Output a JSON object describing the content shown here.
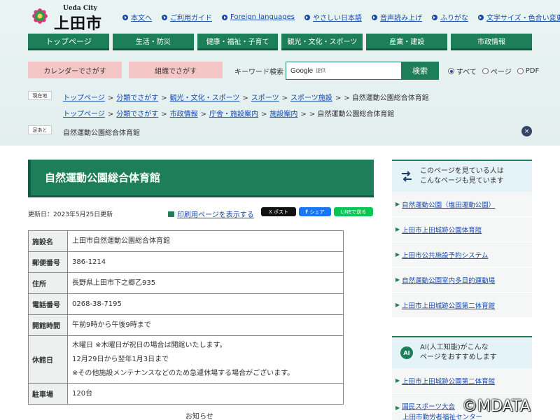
{
  "site": {
    "logo_latin": "Ueda City",
    "logo_jp": "上田市"
  },
  "utility_links": [
    {
      "label": "本文へ"
    },
    {
      "label": "ご利用ガイド"
    },
    {
      "label": "Foreign languages"
    },
    {
      "label": "やさしい日本語"
    },
    {
      "label": "音声読み上げ"
    },
    {
      "label": "ふりがな"
    },
    {
      "label": "文字サイズ・色合い変更"
    }
  ],
  "global_nav": [
    {
      "label": "トップページ"
    },
    {
      "label": "生活・防災"
    },
    {
      "label": "健康・福祉・子育て"
    },
    {
      "label": "観光・文化・スポーツ"
    },
    {
      "label": "産業・建設"
    },
    {
      "label": "市政情報"
    }
  ],
  "search": {
    "calendar_label": "カレンダーでさがす",
    "org_label": "組織でさがす",
    "keyword_label": "キーワード検索",
    "google_label": "Google",
    "provided_label": "提供",
    "button_label": "検索",
    "scope_options": [
      {
        "label": "すべて",
        "selected": true
      },
      {
        "label": "ページ",
        "selected": false
      },
      {
        "label": "PDF",
        "selected": false
      }
    ]
  },
  "breadcrumbs": {
    "current_label": "現在地",
    "trail_1": [
      "トップページ",
      "分類でさがす",
      "観光・文化・スポーツ",
      "スポーツ",
      "スポーツ施設"
    ],
    "trail_1_end": "> 自然運動公園総合体育館",
    "trail_2": [
      "トップページ",
      "分類でさがす",
      "市政情報",
      "庁舎・施設案内",
      "施設案内"
    ],
    "trail_2_end": "> 自然運動公園総合体育館",
    "history_label": "足あと",
    "history_item": "自然運動公園総合体育館",
    "close_icon": "×"
  },
  "page": {
    "title": "自然運動公園総合体育館",
    "updated": "更新日：2023年5月25日更新",
    "print_label": "印刷用ページを表示する",
    "sns": {
      "x_label": "X ポスト",
      "fb_label": "シェア",
      "line_label": "LINEで送る"
    },
    "table": [
      {
        "key": "施設名",
        "values": [
          "上田市自然運動公園総合体育館"
        ]
      },
      {
        "key": "郵便番号",
        "values": [
          "386-1214"
        ]
      },
      {
        "key": "住所",
        "values": [
          "長野県上田市下之郷乙935"
        ]
      },
      {
        "key": "電話番号",
        "values": [
          "0268-38-7195"
        ]
      },
      {
        "key": "開館時間",
        "values": [
          "午前9時から午後9時まで"
        ]
      },
      {
        "key": "休館日",
        "values": [
          "木曜日 ※木曜日が祝日の場合は開館いたします。",
          "12月29日から翌年1月3日まで",
          "※その他施設メンテナンスなどのため急遽休場する場合がございます。"
        ]
      },
      {
        "key": "駐車場",
        "values": [
          "120台"
        ]
      }
    ],
    "notice": "お知らせ"
  },
  "sidebar": {
    "related_head": "このページを見ている人は\nこんなページも見ています",
    "related_items": [
      {
        "label": "自然運動公園（塩田運動公園）"
      },
      {
        "label": "上田市上田城跡公園体育館"
      },
      {
        "label": "上田市公共施設予約システム"
      },
      {
        "label": "自然運動公園室内多目的運動場"
      },
      {
        "label": "上田市上田城跡公園第二体育館"
      }
    ],
    "ai_badge": "AI",
    "ai_head": "AI(人工知能)がこんな\nページをおすすめします",
    "ai_items": [
      {
        "label": "上田市上田城跡公園第二体育館"
      },
      {
        "label": "国民スポーツ大会"
      },
      {
        "label": "上田市勤労者福祉センター"
      }
    ]
  },
  "watermark": "©MDATA",
  "colors": {
    "brand_green": "#1d7f5a",
    "link_blue": "#1a4aa8",
    "pink_button": "#f4c6c6",
    "header_bg": "#e6f1f1"
  }
}
